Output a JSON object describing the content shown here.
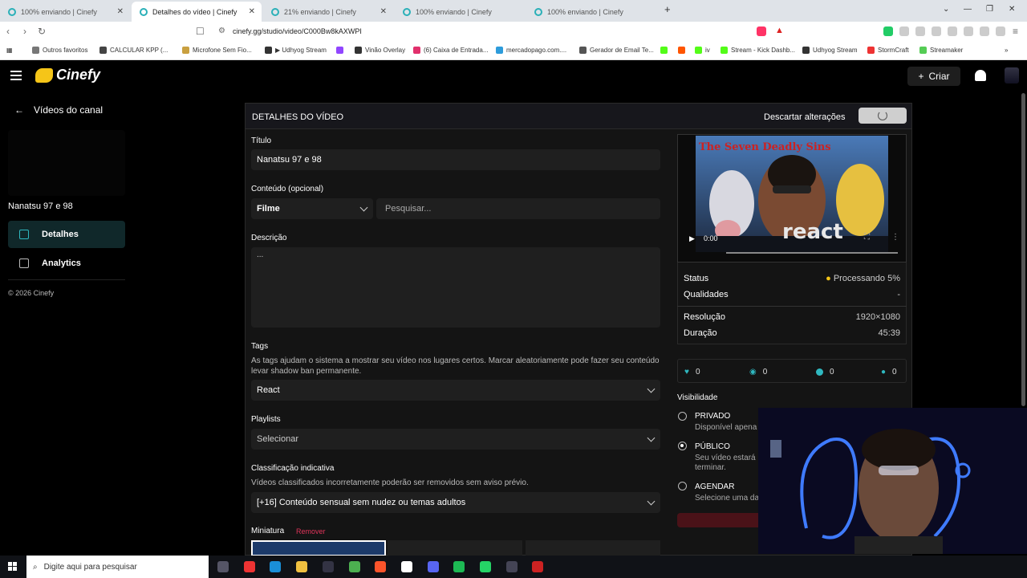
{
  "browser": {
    "tabs": [
      {
        "label": "100% enviando | Cinefy",
        "active": false
      },
      {
        "label": "Detalhes do vídeo | Cinefy",
        "active": true
      },
      {
        "label": "21% enviando | Cinefy",
        "active": false
      },
      {
        "label": "100% enviando | Cinefy",
        "active": false
      },
      {
        "label": "100% enviando | Cinefy",
        "active": false
      }
    ],
    "url": "cinefy.gg/studio/video/C000Bw8kAXWPI",
    "bookmarks": [
      {
        "label": "Outros favoritos",
        "color": "#666"
      },
      {
        "label": "CALCULAR KPP (...",
        "color": "#444"
      },
      {
        "label": "Microfone Sem Fio...",
        "color": "#c9a040"
      },
      {
        "label": "▶ Udhyog Stream",
        "color": "#333"
      },
      {
        "label": "",
        "color": "#9146ff"
      },
      {
        "label": "Vinão Overlay",
        "color": "#333"
      },
      {
        "label": "(6) Caixa de Entrada...",
        "color": "#e1306c"
      },
      {
        "label": "mercadopago.com....",
        "color": "#2d9cdb"
      },
      {
        "label": "Gerador de Email Te...",
        "color": "#333"
      },
      {
        "label": "",
        "color": "#53fc18"
      },
      {
        "label": "",
        "color": "#ff5500"
      },
      {
        "label": "iv",
        "color": "#53fc18"
      },
      {
        "label": "Stream - Kick Dashb...",
        "color": "#53fc18"
      },
      {
        "label": "Udhyog Stream",
        "color": "#333"
      },
      {
        "label": "StormCraft",
        "color": "#e33"
      },
      {
        "label": "Streamaker",
        "color": "#5c5"
      }
    ]
  },
  "header": {
    "logo_text": "Cinefy",
    "create_label": "Criar"
  },
  "sidebar": {
    "back_label": "Vídeos do canal",
    "video_title": "Nanatsu 97 e 98",
    "items": [
      {
        "label": "Detalhes",
        "active": true
      },
      {
        "label": "Analytics",
        "active": false
      }
    ],
    "copyright": "© 2026 Cinefy"
  },
  "panel": {
    "title": "DETALHES DO VÍDEO",
    "discard_label": "Descartar alterações",
    "fields": {
      "title_label": "Título",
      "title_value": "Nanatsu 97 e 98",
      "content_label": "Conteúdo (opcional)",
      "content_type": "Filme",
      "content_search_placeholder": "Pesquisar...",
      "description_label": "Descrição",
      "description_value": "...",
      "tags_label": "Tags",
      "tags_hint": "As tags ajudam o sistema a mostrar seu vídeo nos lugares certos. Marcar aleatoriamente pode fazer seu conteúdo levar shadow ban permanente.",
      "tags_value": "React",
      "playlists_label": "Playlists",
      "playlists_value": "Selecionar",
      "rating_label": "Classificação indicativa",
      "rating_hint": "Vídeos classificados incorretamente poderão ser removidos sem aviso prévio.",
      "rating_value": "[+16] Conteúdo sensual sem nudez ou temas adultos",
      "thumbnail_label": "Miniatura",
      "thumbnail_remove": "Remover"
    }
  },
  "video_info": {
    "poster_title": "The Seven Deadly Sins",
    "poster_text": "react",
    "time": "0:00",
    "status_label": "Status",
    "status_value": "Processando 5%",
    "status_color": "#f5c518",
    "qualities_label": "Qualidades",
    "qualities_value": "-",
    "resolution_label": "Resolução",
    "resolution_value": "1920×1080",
    "duration_label": "Duração",
    "duration_value": "45:39",
    "stats": [
      {
        "icon": "heart-icon",
        "value": "0",
        "color": "#2fb8c0"
      },
      {
        "icon": "eye-icon",
        "value": "0",
        "color": "#2fb8c0"
      },
      {
        "icon": "dot-icon",
        "value": "0",
        "color": "#2fb8c0"
      },
      {
        "icon": "comment-icon",
        "value": "0",
        "color": "#2fb8c0"
      }
    ]
  },
  "visibility": {
    "label": "Visibilidade",
    "options": [
      {
        "title": "PRIVADO",
        "desc": "Disponível apena",
        "selected": false
      },
      {
        "title": "PÚBLICO",
        "desc": "Seu vídeo estará\nterminar.",
        "selected": true
      },
      {
        "title": "AGENDAR",
        "desc": "Selecione uma da",
        "selected": false
      }
    ]
  },
  "taskbar": {
    "search_placeholder": "Digite aqui para pesquisar"
  }
}
